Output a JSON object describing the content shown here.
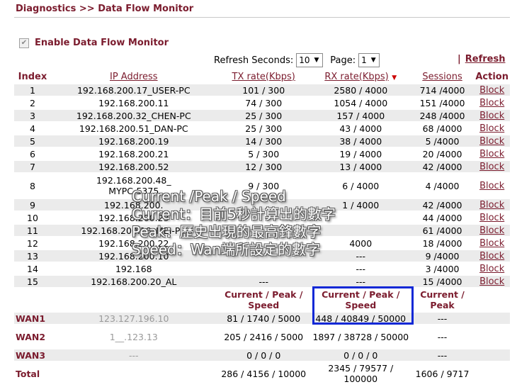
{
  "page": {
    "title": "Diagnostics >> Data Flow Monitor",
    "enable_label": "Enable Data Flow Monitor",
    "refresh_seconds_label": "Refresh Seconds:",
    "refresh_seconds_value": "10",
    "page_label": "Page:",
    "page_value": "1",
    "refresh_sep": "|",
    "refresh_link": "Refresh"
  },
  "table": {
    "headers": [
      "Index",
      "IP Address",
      "TX rate(Kbps)",
      "RX rate(Kbps)",
      "Sessions",
      "Action"
    ],
    "rows": [
      {
        "index": "1",
        "ip": "192.168.200.17_USER-PC",
        "tx": "101 / 300",
        "rx": "2580 / 4000",
        "sessions": "714 /4000",
        "action": "Block"
      },
      {
        "index": "2",
        "ip": "192.168.200.11",
        "tx": "74 / 300",
        "rx": "1054 / 4000",
        "sessions": "151 /4000",
        "action": "Block"
      },
      {
        "index": "3",
        "ip": "192.168.200.32_CHEN-PC",
        "tx": "25 / 300",
        "rx": "157 / 4000",
        "sessions": "248 /4000",
        "action": "Block"
      },
      {
        "index": "4",
        "ip": "192.168.200.51_DAN-PC",
        "tx": "25 / 300",
        "rx": "43 / 4000",
        "sessions": "68 /4000",
        "action": "Block"
      },
      {
        "index": "5",
        "ip": "192.168.200.19",
        "tx": "14 / 300",
        "rx": "38 / 4000",
        "sessions": "5 /4000",
        "action": "Block"
      },
      {
        "index": "6",
        "ip": "192.168.200.21",
        "tx": "5 / 300",
        "rx": "19 / 4000",
        "sessions": "20 /4000",
        "action": "Block"
      },
      {
        "index": "7",
        "ip": "192.168.200.52",
        "tx": "12 / 300",
        "rx": "13 / 4000",
        "sessions": "42 /4000",
        "action": "Block"
      },
      {
        "index": "8",
        "ip": "192.168.200.48_\nMYPC-5375",
        "tx": "9 / 300",
        "rx": "6 / 4000",
        "sessions": "4 /4000",
        "action": "Block"
      },
      {
        "index": "9",
        "ip": "192.168.200.",
        "tx": "",
        "rx": "1 / 4000",
        "sessions": "42 /4000",
        "action": "Block"
      },
      {
        "index": "10",
        "ip": "192.168.200.23",
        "tx": "",
        "rx": "",
        "sessions": "44 /4000",
        "action": "Block"
      },
      {
        "index": "11",
        "ip": "192.168.200.18_MEI-PC",
        "tx": "",
        "rx": "",
        "sessions": "61 /4000",
        "action": "Block"
      },
      {
        "index": "12",
        "ip": "192.168.200.22",
        "tx": "",
        "rx": "4000",
        "sessions": "18 /4000",
        "action": "Block"
      },
      {
        "index": "13",
        "ip": "192.168.200.10",
        "tx": "",
        "rx": "---",
        "sessions": "9 /4000",
        "action": "Block"
      },
      {
        "index": "14",
        "ip": "192.168",
        "tx": "",
        "rx": "---",
        "sessions": "3 /4000",
        "action": "Block"
      },
      {
        "index": "15",
        "ip": "192.168.200.20_AL",
        "tx": "---",
        "rx": "---",
        "sessions": "15 /4000",
        "action": "Block"
      }
    ],
    "wan_headers": {
      "tx": "Current / Peak / Speed",
      "rx": "Current / Peak / Speed",
      "sessions": "Current / Peak"
    },
    "wan_rows": [
      {
        "name": "WAN1",
        "ip": "123.127.196.10",
        "tx": "81 / 1740 / 5000",
        "rx": "448 / 40849 / 50000",
        "sessions": "---"
      },
      {
        "name": "WAN2",
        "ip": "1__.123.13",
        "tx": "205 / 2416 / 5000",
        "rx": "1897 / 38728 / 50000",
        "sessions": "---"
      },
      {
        "name": "WAN3",
        "ip": "---",
        "tx": "0 / 0 / 0",
        "rx": "0 / 0 / 0",
        "sessions": "---"
      },
      {
        "name": "Total",
        "ip": "",
        "tx": "286 / 4156 / 10000",
        "rx": "2345 / 79577 / 100000",
        "sessions": "1606 / 9717"
      }
    ]
  },
  "annotation": {
    "line1": "Current /Peak / Speed",
    "line2": "Current：目前5秒計算出的數字",
    "line3": "Peak：歷史出現的最高鋒數字",
    "line4": "Speed：Wan端所設定的數字",
    "highlight_color": "#1028d6"
  }
}
